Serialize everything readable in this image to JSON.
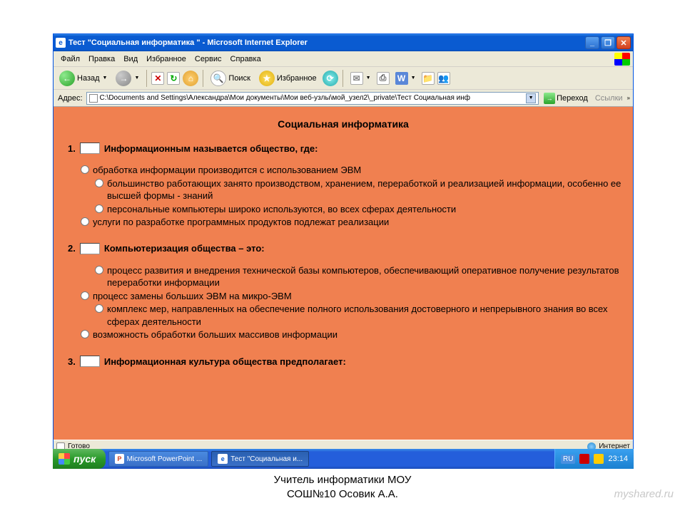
{
  "window": {
    "title": "Тест \"Социальная информатика \" - Microsoft Internet Explorer"
  },
  "menu": {
    "file": "Файл",
    "edit": "Правка",
    "view": "Вид",
    "favorites": "Избранное",
    "tools": "Сервис",
    "help": "Справка"
  },
  "toolbar": {
    "back": "Назад",
    "search": "Поиск",
    "favorites": "Избранное"
  },
  "address": {
    "label": "Адрес:",
    "value": "C:\\Documents and Settings\\Александра\\Мои документы\\Мои веб-узлы\\мой_узел2\\_private\\Тест Социальная инф",
    "go": "Переход",
    "links": "Ссылки"
  },
  "page": {
    "title": "Социальная информатика",
    "questions": [
      {
        "num": "1.",
        "text": "Информационным называется общество, где:",
        "options": [
          "обработка информации производится с использованием ЭВМ",
          "большинство работающих занято производством, хранением, переработкой и реализацией информации, особенно ее высшей формы - знаний",
          "персональные компьютеры широко используются, во всех сферах деятельности",
          "услуги по разработке программных продуктов подлежат реализации"
        ]
      },
      {
        "num": "2.",
        "text": "Компьютеризация общества – это:",
        "options": [
          "процесс развития и внедрения технической базы компьютеров, обеспечивающий оперативное получение результатов переработки информации",
          "процесс замены больших ЭВМ на микро-ЭВМ",
          "комплекс мер, направленных на обеспечение полного использования достоверного и непрерывного знания во всех сферах деятельности",
          "возможность обработки больших массивов информации"
        ]
      },
      {
        "num": "3.",
        "text": "Информационная культура общества предполагает:",
        "options": []
      }
    ]
  },
  "status": {
    "ready": "Готово",
    "zone": "Интернет"
  },
  "taskbar": {
    "start": "пуск",
    "task1": "Microsoft PowerPoint ...",
    "task2": "Тест \"Социальная и...",
    "lang": "RU",
    "time": "23:14"
  },
  "caption": {
    "line1": "Учитель информатики МОУ",
    "line2": "СОШ№10 Осовик А.А."
  },
  "watermark": "myshared.ru"
}
